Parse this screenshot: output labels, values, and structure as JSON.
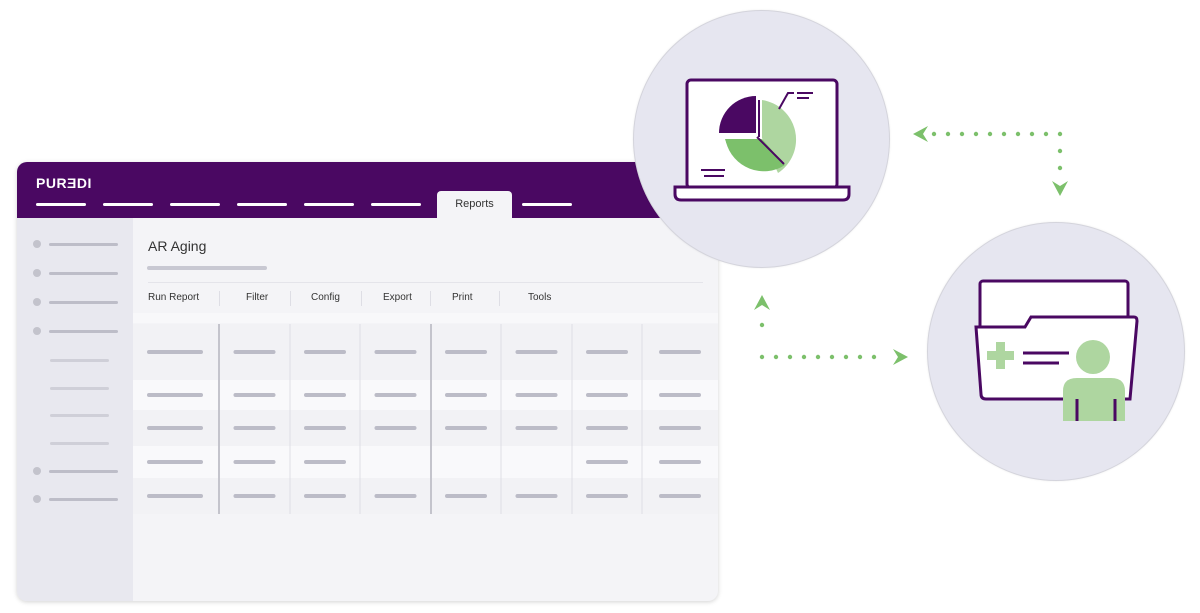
{
  "app": {
    "logo": "PURƎDI",
    "active_tab": "Reports"
  },
  "page": {
    "title": "AR Aging"
  },
  "toolbar": {
    "items": [
      "Run Report",
      "Filter",
      "Config",
      "Export",
      "Print",
      "Tools"
    ]
  },
  "table": {
    "columns": 8,
    "rows": [
      [
        1,
        1,
        1,
        1,
        1,
        1,
        1,
        1
      ],
      [
        1,
        1,
        1,
        1,
        1,
        1,
        1,
        1
      ],
      [
        1,
        1,
        1,
        1,
        1,
        1,
        1,
        1
      ],
      [
        1,
        1,
        1,
        0,
        0,
        0,
        1,
        1
      ],
      [
        1,
        1,
        1,
        1,
        1,
        1,
        1,
        1
      ]
    ]
  },
  "icons": {
    "report": "laptop-pie-chart-icon",
    "record": "medical-folder-patient-icon"
  },
  "colors": {
    "brand": "#4a0862",
    "green": "#7cc06b",
    "light_green": "#aed6a0",
    "circle": "#e6e6f0"
  }
}
